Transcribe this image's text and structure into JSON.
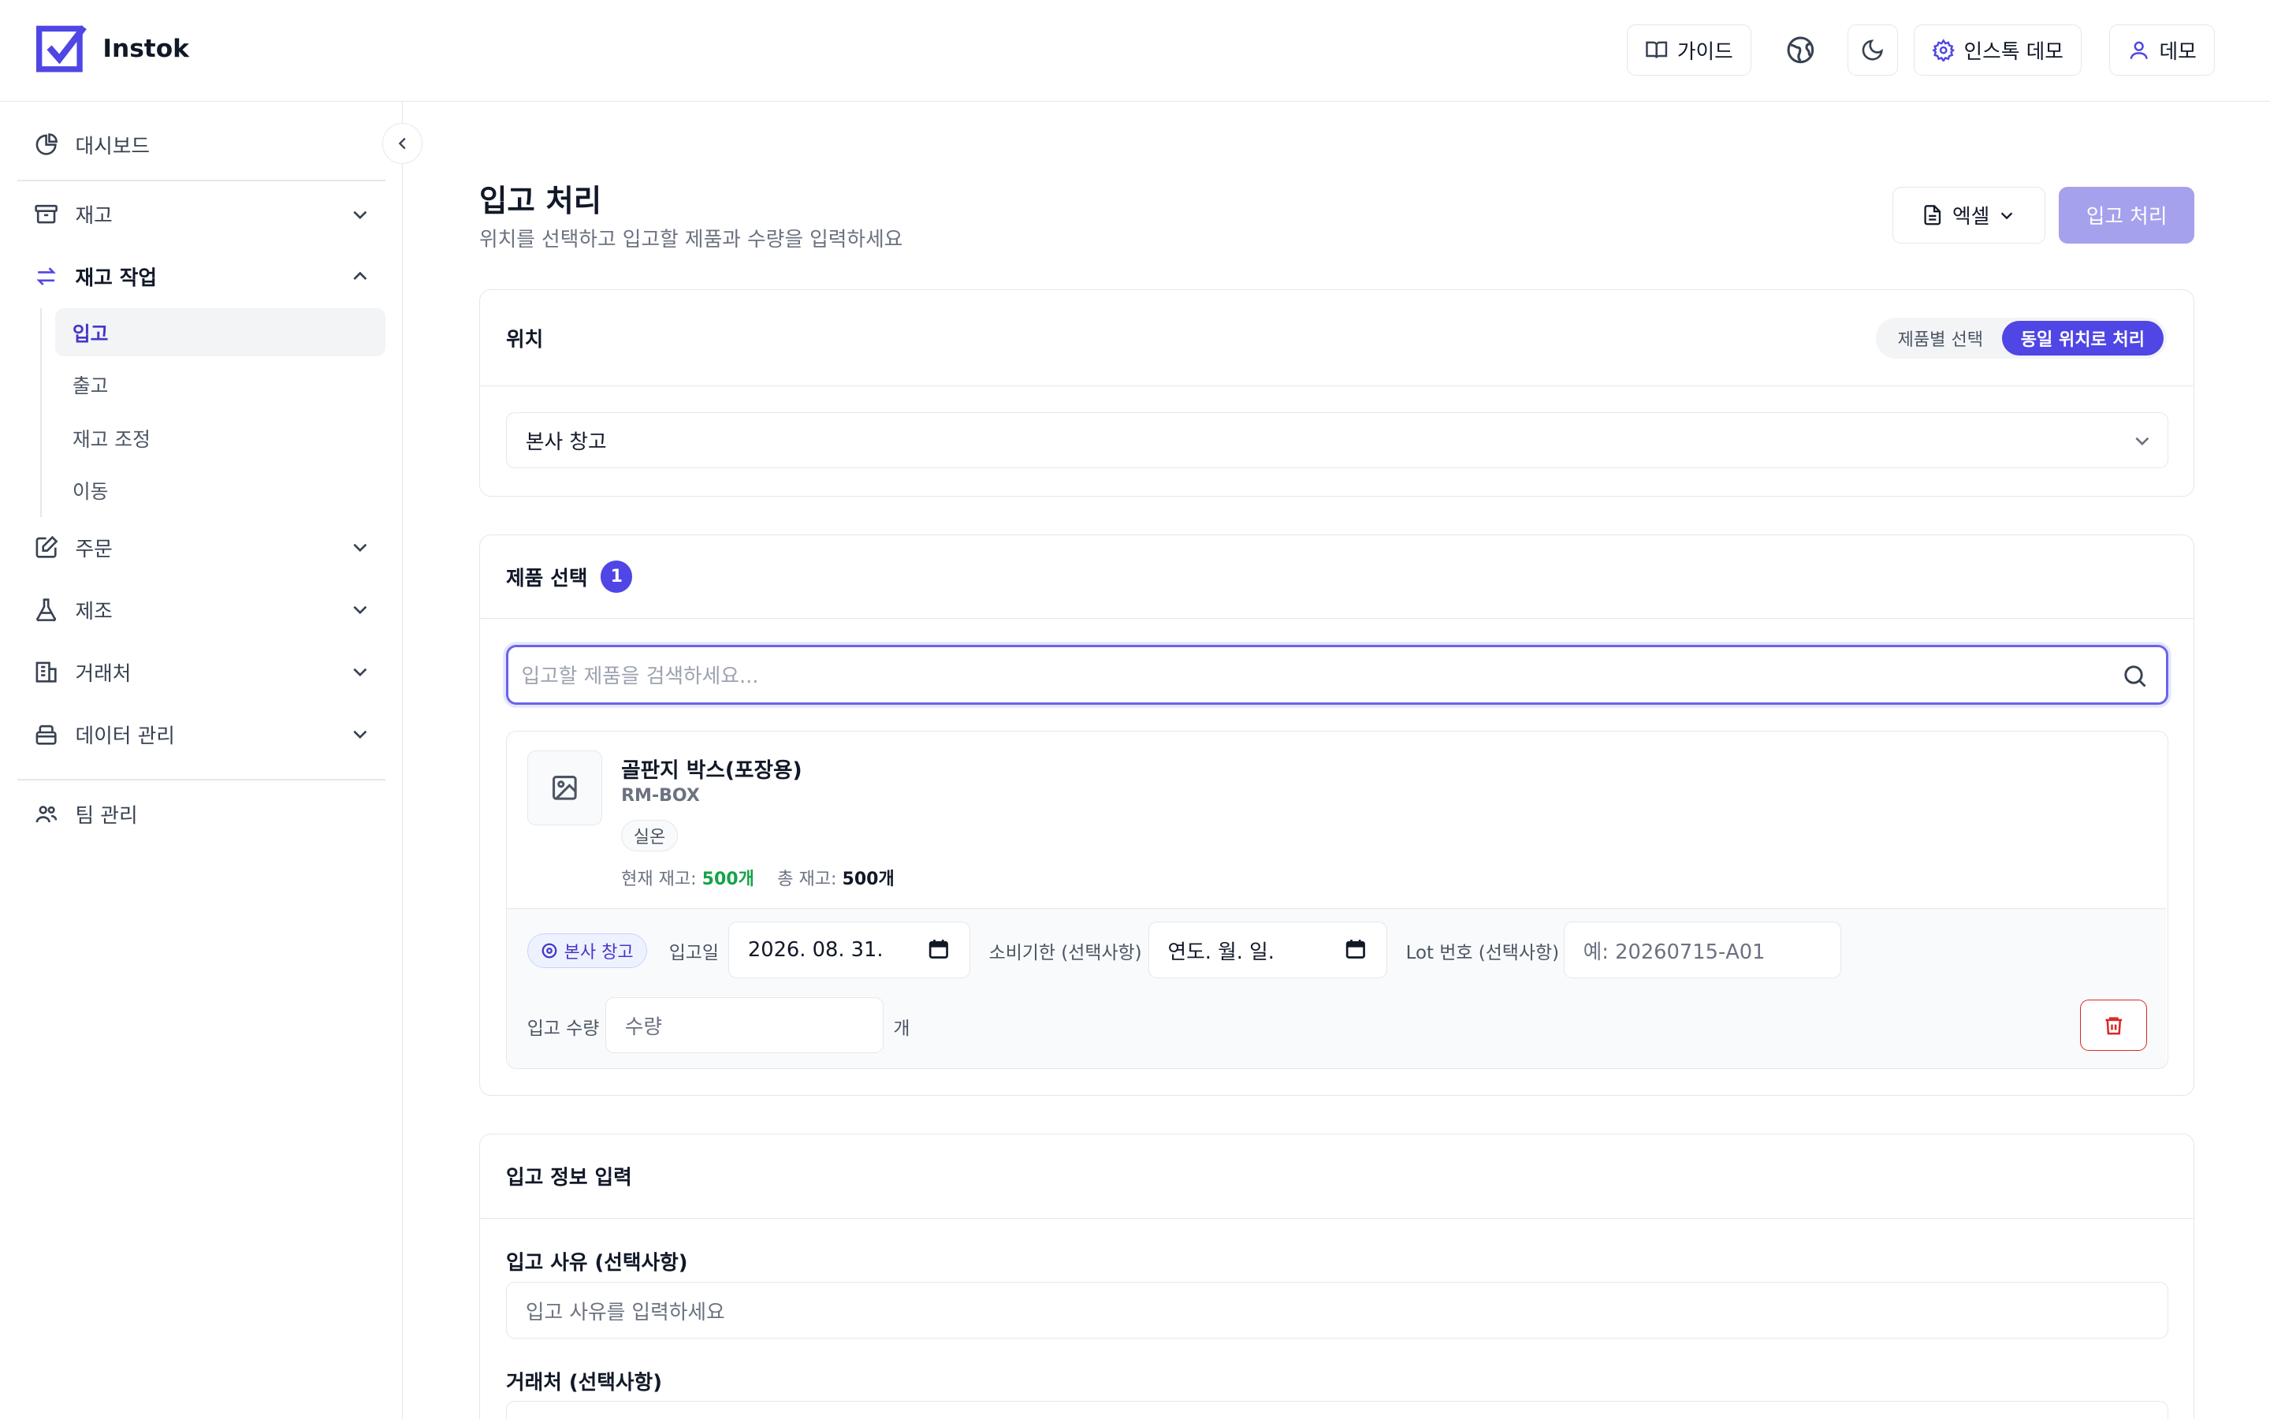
{
  "app": {
    "name": "Instok",
    "brand_color": "#4f46e5"
  },
  "header": {
    "guide_label": "가이드",
    "globe_icon": "globe-icon",
    "theme_icon": "moon-icon",
    "company_label": "인스톡 데모",
    "user_label": "데모"
  },
  "sidebar": {
    "dashboard": "대시보드",
    "inventory": "재고",
    "stock_ops": "재고 작업",
    "sub_items": [
      "입고",
      "출고",
      "재고 조정",
      "이동"
    ],
    "orders": "주문",
    "manufacturing": "제조",
    "partners": "거래처",
    "data_mgmt": "데이터 관리",
    "team": "팀 관리"
  },
  "page": {
    "title": "입고 처리",
    "subtitle": "위치를 선택하고 입고할 제품과 수량을 입력하세요",
    "excel_label": "엑셀",
    "submit_label": "입고 처리"
  },
  "location_card": {
    "title": "위치",
    "seg_options": [
      "제품별 선택",
      "동일 위치로 처리"
    ],
    "seg_selected": 1,
    "selected_location": "본사 창고"
  },
  "product_card": {
    "title": "제품 선택",
    "count": "1",
    "search_placeholder": "입고할 제품을 검색하세요...",
    "item": {
      "name": "골판지 박스(포장용)",
      "sku": "RM-BOX",
      "tag": "실온",
      "current_stock_label": "현재 재고:",
      "current_stock": "500개",
      "total_stock_label": "총 재고:",
      "total_stock": "500개",
      "location": "본사 창고",
      "received_date_label": "입고일",
      "received_date": "2026. 08. 31.",
      "expiry_label": "소비기한 (선택사항)",
      "expiry_value": "연도. 월. 일.",
      "lot_label": "Lot 번호 (선택사항)",
      "lot_placeholder": "예: 20260715-A01",
      "qty_label": "입고 수량",
      "qty_placeholder": "수량",
      "unit": "개"
    }
  },
  "info_card": {
    "title": "입고 정보 입력",
    "reason_label": "입고 사유 (선택사항)",
    "reason_placeholder": "입고 사유를 입력하세요",
    "partner_label": "거래처 (선택사항)"
  }
}
